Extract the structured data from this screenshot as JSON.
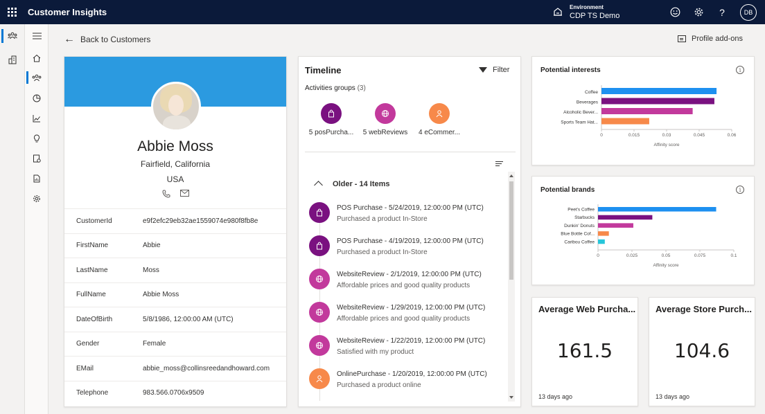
{
  "app": {
    "title": "Customer Insights"
  },
  "environment": {
    "label": "Environment",
    "value": "CDP TS Demo"
  },
  "user": {
    "initials": "DB"
  },
  "nav": {
    "back_label": "Back to Customers",
    "profile_addons_label": "Profile add-ons"
  },
  "profile": {
    "name": "Abbie Moss",
    "city": "Fairfield, California",
    "country": "USA",
    "attributes": [
      {
        "key": "CustomerId",
        "value": "e9f2efc29eb32ae1559074e980f8fb8e"
      },
      {
        "key": "FirstName",
        "value": "Abbie"
      },
      {
        "key": "LastName",
        "value": "Moss"
      },
      {
        "key": "FullName",
        "value": "Abbie Moss"
      },
      {
        "key": "DateOfBirth",
        "value": "5/8/1986, 12:00:00 AM (UTC)"
      },
      {
        "key": "Gender",
        "value": "Female"
      },
      {
        "key": "EMail",
        "value": "abbie_moss@collinsreedandhoward.com"
      },
      {
        "key": "Telephone",
        "value": "983.566.0706x9509"
      }
    ]
  },
  "timeline": {
    "title": "Timeline",
    "filter_label": "Filter",
    "groups_label": "Activities groups",
    "groups_count": "(3)",
    "groups": [
      {
        "label": "5 posPurcha...",
        "icon": "shopping-bag-icon",
        "color": "#7a1180"
      },
      {
        "label": "5 webReviews",
        "icon": "globe-icon",
        "color": "#c2399c"
      },
      {
        "label": "4 eCommer...",
        "icon": "person-icon",
        "color": "#f7894a"
      }
    ],
    "section_label": "Older - 14 Items",
    "items": [
      {
        "title": "POS Purchase - 5/24/2019, 12:00:00 PM (UTC)",
        "subtitle": "Purchased a product In-Store",
        "icon": "shopping-bag-icon",
        "color": "#7a1180"
      },
      {
        "title": "POS Purchase - 4/19/2019, 12:00:00 PM (UTC)",
        "subtitle": "Purchased a product In-Store",
        "icon": "shopping-bag-icon",
        "color": "#7a1180"
      },
      {
        "title": "WebsiteReview - 2/1/2019, 12:00:00 PM (UTC)",
        "subtitle": "Affordable prices and good quality products",
        "icon": "globe-icon",
        "color": "#c2399c"
      },
      {
        "title": "WebsiteReview - 1/29/2019, 12:00:00 PM (UTC)",
        "subtitle": "Affordable prices and good quality products",
        "icon": "globe-icon",
        "color": "#c2399c"
      },
      {
        "title": "WebsiteReview - 1/22/2019, 12:00:00 PM (UTC)",
        "subtitle": "Satisfied with my product",
        "icon": "globe-icon",
        "color": "#c2399c"
      },
      {
        "title": "OnlinePurchase - 1/20/2019, 12:00:00 PM (UTC)",
        "subtitle": "Purchased a product online",
        "icon": "person-icon",
        "color": "#f7894a"
      }
    ]
  },
  "chart_data": [
    {
      "type": "bar",
      "orientation": "horizontal",
      "title": "Potential interests",
      "categories": [
        "Coffee",
        "Beverages",
        "Alcoholic Bever...",
        "Sports Team Hat..."
      ],
      "values": [
        0.053,
        0.052,
        0.042,
        0.022
      ],
      "colors": [
        "#1e90f0",
        "#7a1180",
        "#c2399c",
        "#f7894a"
      ],
      "xlabel": "Affinity score",
      "xlim": [
        0,
        0.06
      ],
      "xticks": [
        "0",
        "0.015",
        "0.03",
        "0.045",
        "0.06"
      ]
    },
    {
      "type": "bar",
      "orientation": "horizontal",
      "title": "Potential brands",
      "categories": [
        "Peet's Coffee",
        "Starbucks",
        "Dunkin' Donuts",
        "Blue Bottle Cof...",
        "Caribou Coffee"
      ],
      "values": [
        0.087,
        0.04,
        0.026,
        0.008,
        0.005
      ],
      "colors": [
        "#1e90f0",
        "#7a1180",
        "#c2399c",
        "#f7894a",
        "#26c6da"
      ],
      "xlabel": "Affinity score",
      "xlim": [
        0,
        0.1
      ],
      "xticks": [
        "0",
        "0.025",
        "0.05",
        "0.075",
        "0.1"
      ]
    }
  ],
  "kpis": [
    {
      "title": "Average Web Purcha...",
      "value": "161.5",
      "footer": "13 days ago"
    },
    {
      "title": "Average Store Purch...",
      "value": "104.6",
      "footer": "13 days ago"
    }
  ]
}
